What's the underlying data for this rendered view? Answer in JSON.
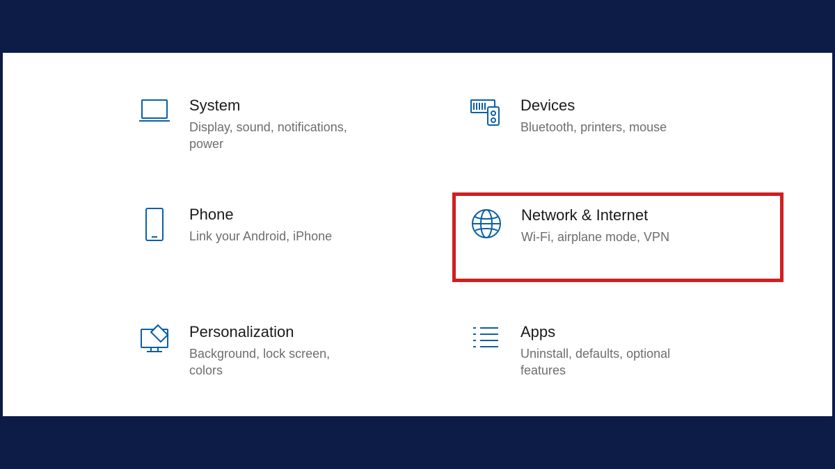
{
  "settings": {
    "items": [
      {
        "id": "system",
        "title": "System",
        "desc": "Display, sound, notifications, power",
        "icon": "laptop-icon",
        "highlighted": false
      },
      {
        "id": "devices",
        "title": "Devices",
        "desc": "Bluetooth, printers, mouse",
        "icon": "devices-icon",
        "highlighted": false
      },
      {
        "id": "phone",
        "title": "Phone",
        "desc": "Link your Android, iPhone",
        "icon": "phone-icon",
        "highlighted": false
      },
      {
        "id": "network",
        "title": "Network & Internet",
        "desc": "Wi-Fi, airplane mode, VPN",
        "icon": "globe-icon",
        "highlighted": true
      },
      {
        "id": "personalization",
        "title": "Personalization",
        "desc": "Background, lock screen, colors",
        "icon": "personalization-icon",
        "highlighted": false
      },
      {
        "id": "apps",
        "title": "Apps",
        "desc": "Uninstall, defaults, optional features",
        "icon": "apps-icon",
        "highlighted": false
      }
    ]
  },
  "colors": {
    "iconStroke": "#0b5fa5",
    "highlightBorder": "#d01f1f",
    "background": "#0d1b47"
  }
}
